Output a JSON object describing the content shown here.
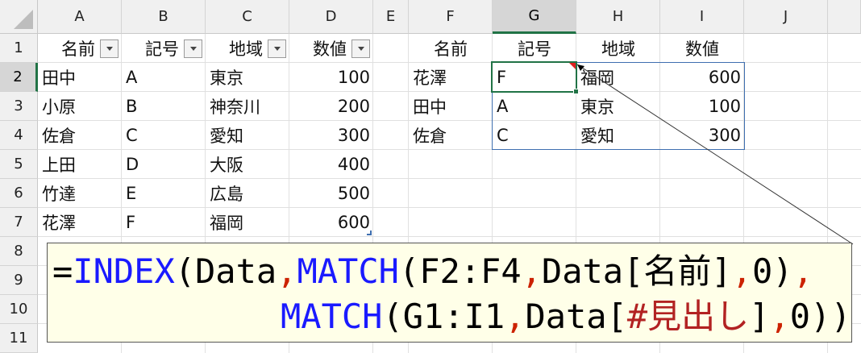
{
  "columns": [
    "A",
    "B",
    "C",
    "D",
    "E",
    "F",
    "G",
    "H",
    "I",
    "J"
  ],
  "selected_column": "G",
  "rows": [
    "1",
    "2",
    "3",
    "4",
    "5",
    "6",
    "7",
    "8",
    "9",
    "10",
    "11"
  ],
  "selected_row": "2",
  "table1": {
    "headers": [
      "名前",
      "記号",
      "地域",
      "数値"
    ],
    "rows": [
      [
        "田中",
        "A",
        "東京",
        "100"
      ],
      [
        "小原",
        "B",
        "神奈川",
        "200"
      ],
      [
        "佐倉",
        "C",
        "愛知",
        "300"
      ],
      [
        "上田",
        "D",
        "大阪",
        "400"
      ],
      [
        "竹達",
        "E",
        "広島",
        "500"
      ],
      [
        "花澤",
        "F",
        "福岡",
        "600"
      ]
    ]
  },
  "table2": {
    "headers": [
      "名前",
      "記号",
      "地域",
      "数値"
    ],
    "rows": [
      [
        "花澤",
        "F",
        "福岡",
        "600"
      ],
      [
        "田中",
        "A",
        "東京",
        "100"
      ],
      [
        "佐倉",
        "C",
        "愛知",
        "300"
      ]
    ]
  },
  "formula": {
    "line1": {
      "eq": "=",
      "fn1": "INDEX",
      "p1": "(Data",
      "c1": ",",
      "fn2": "MATCH",
      "p2": "(F2:F4",
      "c2": ",",
      "p3": "Data[名前]",
      "c3": ",",
      "p4": "0)",
      "c4": ","
    },
    "line2": {
      "fn3": "MATCH",
      "p5": "(G1:I1",
      "c5": ",",
      "p6": "Data[",
      "hash": "#見出し",
      "p7": "]",
      "c6": ",",
      "p8": "0))"
    }
  },
  "colors": {
    "selection": "#217346",
    "spill_border": "#3f6fb0",
    "function": "#1a1aff",
    "comma": "#cc2200",
    "formula_bg": "#ffffe8"
  }
}
